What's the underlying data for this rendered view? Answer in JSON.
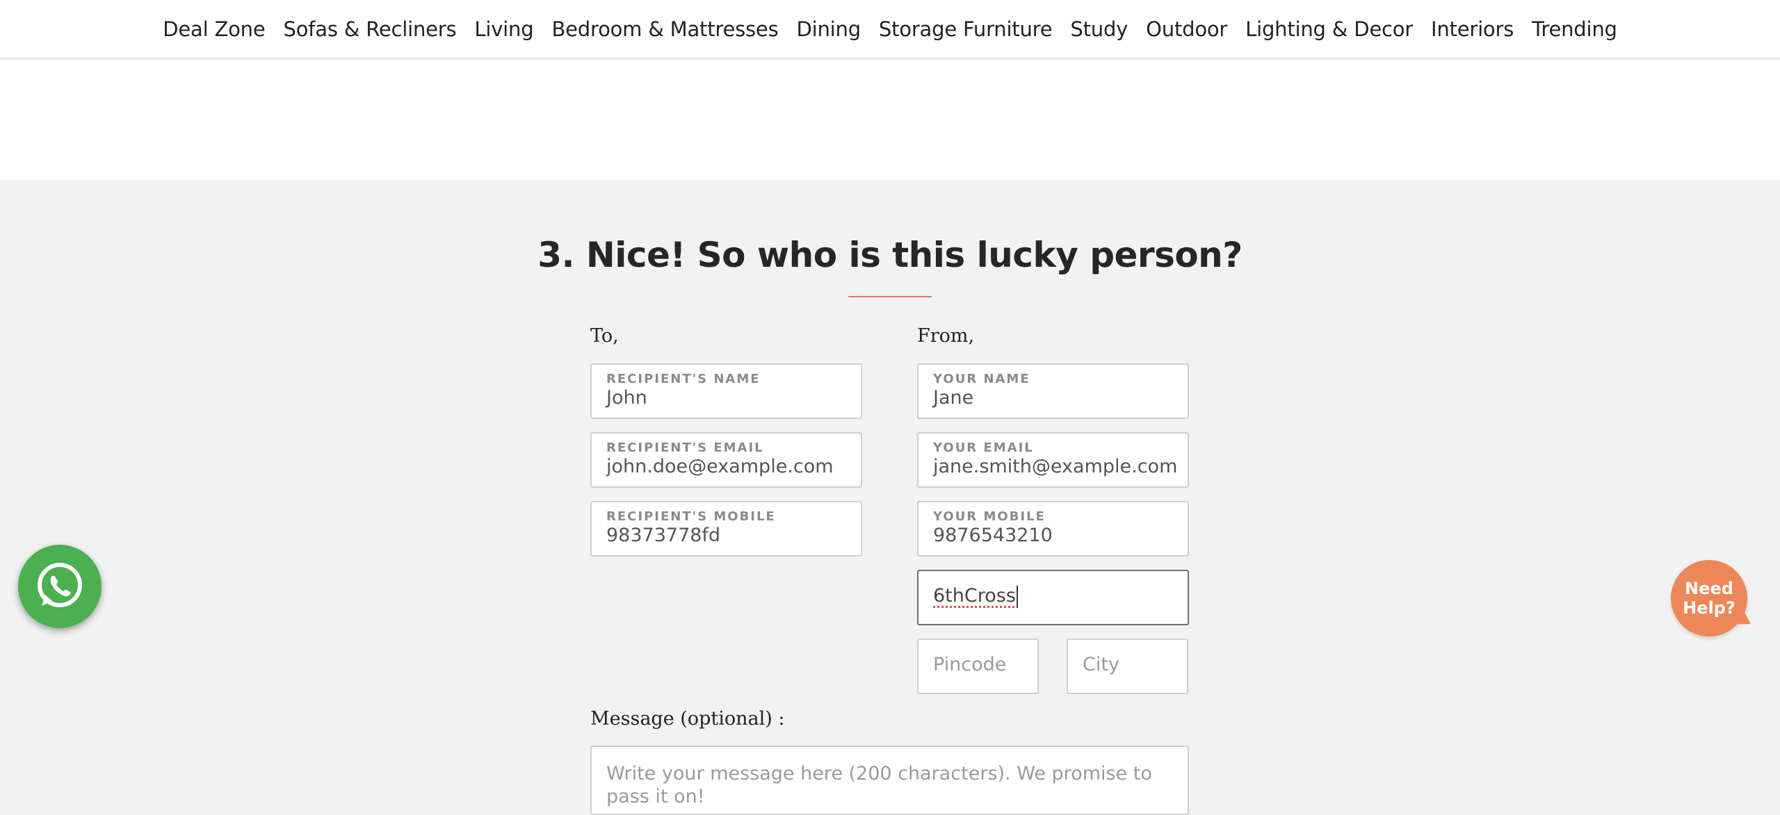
{
  "nav": {
    "items": [
      "Deal Zone",
      "Sofas & Recliners",
      "Living",
      "Bedroom & Mattresses",
      "Dining",
      "Storage Furniture",
      "Study",
      "Outdoor",
      "Lighting & Decor",
      "Interiors",
      "Trending"
    ]
  },
  "form": {
    "heading": "3. Nice! So who is this lucky person?",
    "to_label": "To,",
    "from_label": "From,",
    "recipient": {
      "name_label": "RECIPIENT'S NAME",
      "name_value": "John",
      "email_label": "RECIPIENT'S EMAIL",
      "email_value": "john.doe@example.com",
      "mobile_label": "RECIPIENT'S MOBILE",
      "mobile_value": "98373778fd"
    },
    "sender": {
      "name_label": "YOUR NAME",
      "name_value": "Jane",
      "email_label": "YOUR EMAIL",
      "email_value": "jane.smith@example.com",
      "mobile_label": "YOUR MOBILE",
      "mobile_value": "9876543210",
      "address_value": "6thCross",
      "pincode_placeholder": "Pincode",
      "city_placeholder": "City"
    },
    "message_label": "Message (optional) :",
    "message_placeholder": "Write your message here (200 characters). We promise to pass it on!"
  },
  "widgets": {
    "whatsapp_icon": "whatsapp-icon",
    "need_help_line1": "Need",
    "need_help_line2": "Help?"
  },
  "colors": {
    "accent": "#e07b4c",
    "need_help_bg": "#ee8757",
    "whatsapp_bg": "#4caf50",
    "section_bg": "#f2f2f2"
  }
}
